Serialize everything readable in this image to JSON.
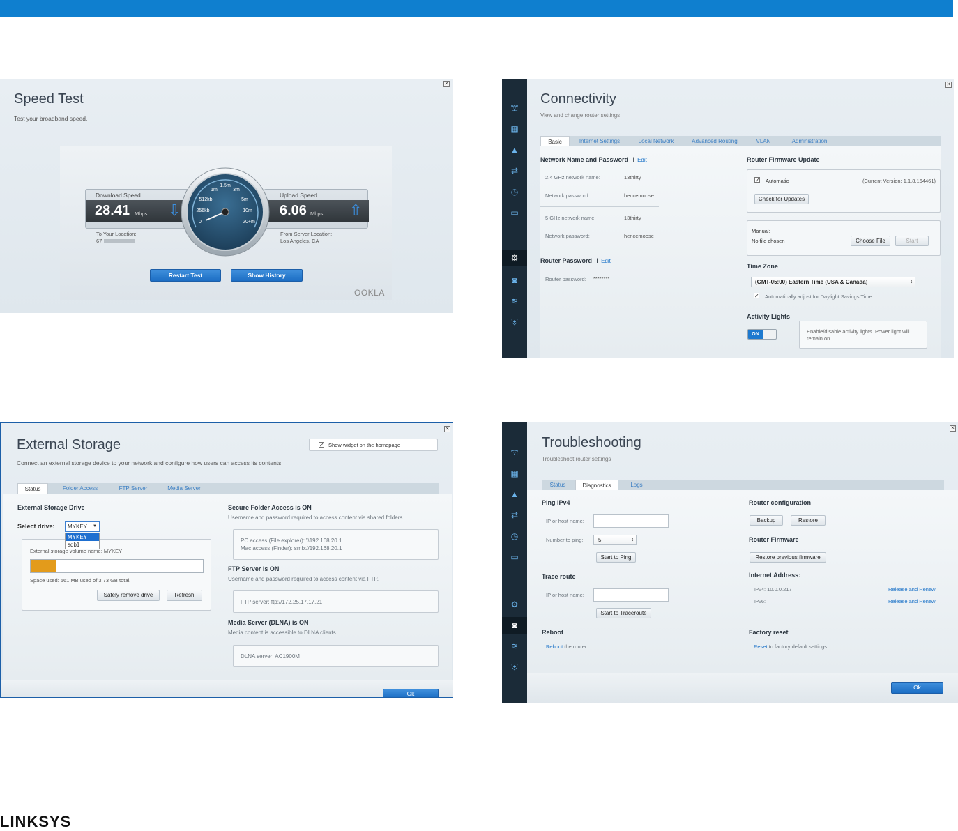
{
  "speedtest": {
    "title": "Speed Test",
    "subtitle": "Test your broadband speed.",
    "download_label": "Download Speed",
    "download_value": "28.41",
    "download_unit": "Mbps",
    "upload_label": "Upload Speed",
    "upload_value": "6.06",
    "upload_unit": "Mbps",
    "to_location_label": "To Your Location:",
    "to_location_value": "67",
    "from_location_label": "From Server Location:",
    "from_location_value": "Los Angeles, CA",
    "gauge_labels": [
      "1m",
      "1.5m",
      "3m",
      "512kb",
      "5m",
      "256kb",
      "10m",
      "0",
      "20+m"
    ],
    "restart_label": "Restart Test",
    "history_label": "Show History",
    "brand": "OOKLA"
  },
  "connectivity": {
    "title": "Connectivity",
    "subtitle": "View and change router settings",
    "tabs": [
      "Basic",
      "Internet Settings",
      "Local Network",
      "Advanced Routing",
      "VLAN",
      "Administration"
    ],
    "network_heading": "Network Name and Password",
    "edit": "Edit",
    "sep": "I",
    "net24_label": "2.4 GHz network name:",
    "net24_value": "13thirty",
    "netpw1_label": "Network password:",
    "netpw1_value": "hencemoose",
    "net5_label": "5 GHz network name:",
    "net5_value": "13thirty",
    "netpw2_label": "Network password:",
    "netpw2_value": "hencemoose",
    "router_pw_heading": "Router Password",
    "router_pw_label": "Router password:",
    "router_pw_value": "********",
    "firmware_heading": "Router Firmware Update",
    "automatic_label": "Automatic",
    "current_version": "(Current Version: 1.1.8.164461)",
    "check_updates": "Check for Updates",
    "manual_label": "Manual:",
    "no_file": "No file chosen",
    "choose_file": "Choose File",
    "start": "Start",
    "timezone_heading": "Time Zone",
    "timezone_value": "(GMT-05:00) Eastern Time (USA & Canada)",
    "dst_label": "Automatically adjust for Daylight Savings Time",
    "activity_heading": "Activity Lights",
    "toggle_on": "ON",
    "activity_note": "Enable/disable activity lights. Power light will remain on."
  },
  "storage": {
    "title": "External Storage",
    "subtitle": "Connect an external storage device to your network and configure how users can access its contents.",
    "widget_label": "Show widget on the homepage",
    "tabs": [
      "Status",
      "Folder Access",
      "FTP Server",
      "Media Server"
    ],
    "drive_heading": "External Storage Drive",
    "select_label": "Select drive:",
    "select_value": "MYKEY",
    "options": [
      "MYKEY",
      "sdb1"
    ],
    "volume_label": "External storage volume name: MYKEY",
    "usage_fraction": 0.15,
    "space_used": "Space used: 561 MB used of 3.73 GB total.",
    "remove_label": "Safely remove drive",
    "refresh_label": "Refresh",
    "secure_heading": "Secure Folder Access is ON",
    "secure_sub": "Username and password required to access content via shared folders.",
    "pc_access": "PC access (File explorer): \\\\192.168.20.1",
    "mac_access": "Mac access (Finder): smb://192.168.20.1",
    "ftp_heading": "FTP Server is ON",
    "ftp_sub": "Username and password required to access content via FTP.",
    "ftp_server": "FTP server: ftp://172.25.17.17.21",
    "media_heading": "Media Server (DLNA) is ON",
    "media_sub": "Media content is accessible to DLNA clients.",
    "dlna_server": "DLNA server: AC1900M",
    "ok_label": "Ok"
  },
  "troubleshooting": {
    "title": "Troubleshooting",
    "subtitle": "Troubleshoot router settings",
    "tabs": [
      "Status",
      "Diagnostics",
      "Logs"
    ],
    "ping_heading": "Ping IPv4",
    "ip_label": "IP or host name:",
    "number_label": "Number to ping:",
    "number_value": "5",
    "start_ping": "Start to Ping",
    "trace_heading": "Trace route",
    "ip_label2": "IP or host name:",
    "start_trace": "Start to Traceroute",
    "reboot_heading": "Reboot",
    "reboot_link": "Reboot",
    "reboot_rest": " the router",
    "config_heading": "Router configuration",
    "backup": "Backup",
    "restore": "Restore",
    "fw_heading": "Router Firmware",
    "restore_fw": "Restore previous firmware",
    "internet_heading": "Internet Address:",
    "ipv4": "IPv4: 10.0.0.217",
    "ipv6": "IPv6:",
    "release1": "Release and Renew",
    "release2": "Release and Renew",
    "factory_heading": "Factory reset",
    "reset_link": "Reset",
    "reset_rest": " to factory default settings",
    "ok_label": "Ok"
  },
  "logo": "LINKSYS"
}
